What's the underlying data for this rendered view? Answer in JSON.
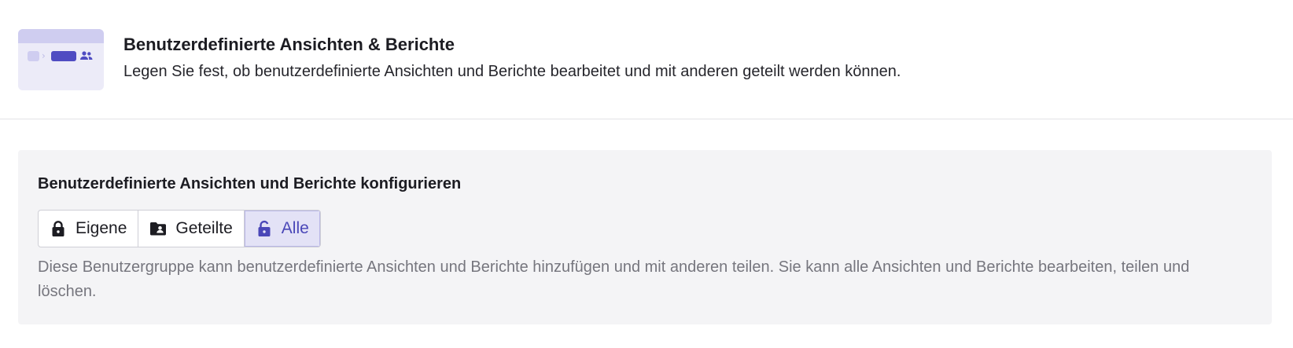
{
  "header": {
    "title": "Benutzerdefinierte Ansichten & Berichte",
    "description": "Legen Sie fest, ob benutzerdefinierte Ansichten und Berichte bearbeitet und mit anderen geteilt werden können.",
    "illustration_icon": "custom-views-illustration-icon"
  },
  "panel": {
    "title": "Benutzerdefinierte Ansichten und Berichte konfigurieren",
    "options": [
      {
        "label": "Eigene",
        "icon": "lock-closed-icon",
        "selected": false
      },
      {
        "label": "Geteilte",
        "icon": "shared-folder-icon",
        "selected": false
      },
      {
        "label": "Alle",
        "icon": "lock-open-icon",
        "selected": true
      }
    ],
    "description": "Diese Benutzergruppe kann benutzerdefinierte Ansichten und Berichte hinzufügen und mit anderen teilen. Sie kann alle Ansichten und Berichte bearbeiten, teilen und löschen."
  },
  "colors": {
    "accent": "#4a47b8",
    "accent_bg": "#e3e2f6",
    "panel_bg": "#f4f4f6",
    "muted_text": "#76767e"
  }
}
